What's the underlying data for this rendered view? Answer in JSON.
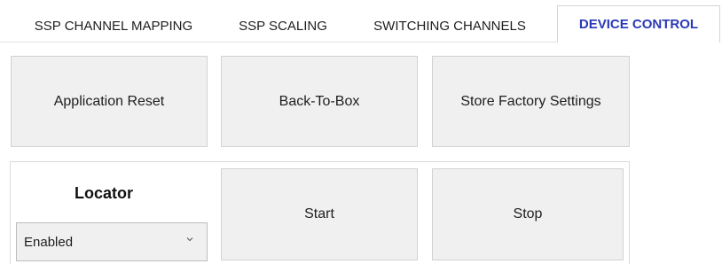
{
  "tabs": [
    {
      "label": "SSP CHANNEL MAPPING",
      "active": false
    },
    {
      "label": "SSP SCALING",
      "active": false
    },
    {
      "label": "SWITCHING CHANNELS",
      "active": false
    },
    {
      "label": "DEVICE CONTROL",
      "active": true
    }
  ],
  "device_control": {
    "application_reset_label": "Application Reset",
    "back_to_box_label": "Back-To-Box",
    "store_factory_settings_label": "Store Factory Settings",
    "locator": {
      "title": "Locator",
      "selected_value": "Enabled",
      "start_label": "Start",
      "stop_label": "Stop"
    }
  },
  "colors": {
    "active_tab_text": "#2a39b6",
    "button_background": "#f0f0f0",
    "button_border": "#d2d2d2"
  },
  "icons": {
    "dropdown": "chevron-down-icon"
  }
}
